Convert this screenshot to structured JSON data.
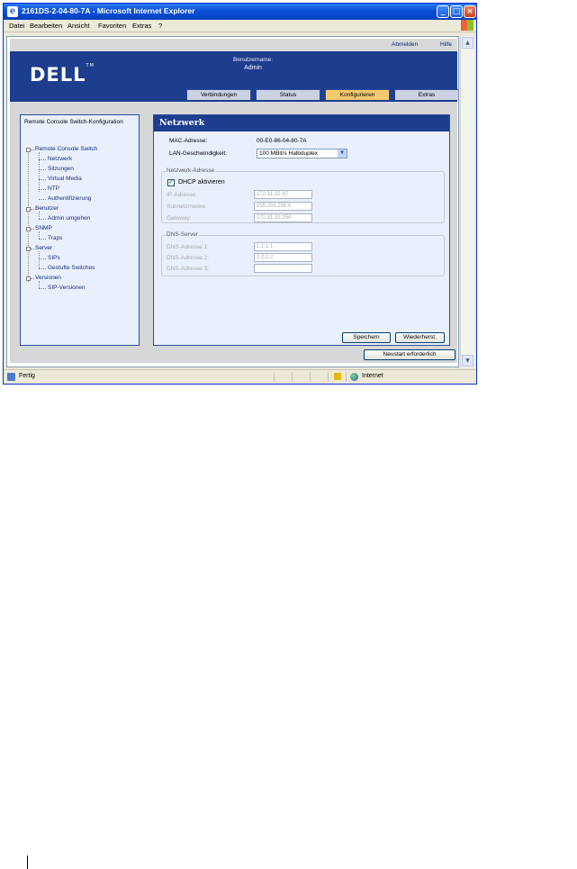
{
  "window": {
    "title": "2161DS-2-04-80-7A - Microsoft Internet Explorer"
  },
  "menu": {
    "items": [
      "Datei",
      "Bearbeiten",
      "Ansicht",
      "Favoriten",
      "Extras",
      "?"
    ]
  },
  "topbar": {
    "logout": "Abmelden",
    "help": "Hilfe"
  },
  "header": {
    "username_label": "Benutzername:",
    "username": "Admin",
    "tabs": [
      "Verbindungen",
      "Status",
      "Konfigurieren",
      "Extras"
    ],
    "active_tab": "Konfigurieren"
  },
  "sidebar": {
    "title": "Remote Console Switch-Konfiguration",
    "tree": [
      {
        "label": "Remote Console Switch",
        "children": [
          "Netzwerk",
          "Sitzungen",
          "Virtual Media",
          "NTP",
          "Authentifizierung"
        ]
      },
      {
        "label": "Benutzer",
        "children": [
          "Admin umgehen"
        ]
      },
      {
        "label": "SNMP",
        "children": [
          "Traps"
        ]
      },
      {
        "label": "Server",
        "children": [
          "SIPs",
          "Gestufte Switches"
        ]
      },
      {
        "label": "Versionen",
        "children": [
          "SIP-Versionen"
        ]
      }
    ]
  },
  "main": {
    "heading": "Netzwerk",
    "mac_label": "MAC-Adresse:",
    "mac_value": "00-E0-86-04-80-7A",
    "lan_label": "LAN-Geschwindigkeit:",
    "lan_value": "100 MBit/s Halbduplex",
    "net_legend": "Netzwerk-Adresse",
    "dhcp_label": "DHCP aktivieren",
    "dhcp_checked": true,
    "ip_label": "IP-Adresse:",
    "ip_value": "172.31.32.97",
    "subnet_label": "Subnetzmaske:",
    "subnet_value": "255.255.255.0",
    "gateway_label": "Gateway:",
    "gateway_value": "172.31.32.254",
    "dns_legend": "DNS-Server",
    "dns1_label": "DNS-Adresse 1:",
    "dns1_value": "1.1.1.1",
    "dns2_label": "DNS-Adresse 2:",
    "dns2_value": "2.2.2.2",
    "dns3_label": "DNS-Adresse 3:",
    "dns3_value": "",
    "save_button": "Speichern",
    "restore_button": "Wiederherst."
  },
  "restart_button": "Neustart erforderlich",
  "status": {
    "text": "Fertig",
    "zone": "Internet"
  }
}
